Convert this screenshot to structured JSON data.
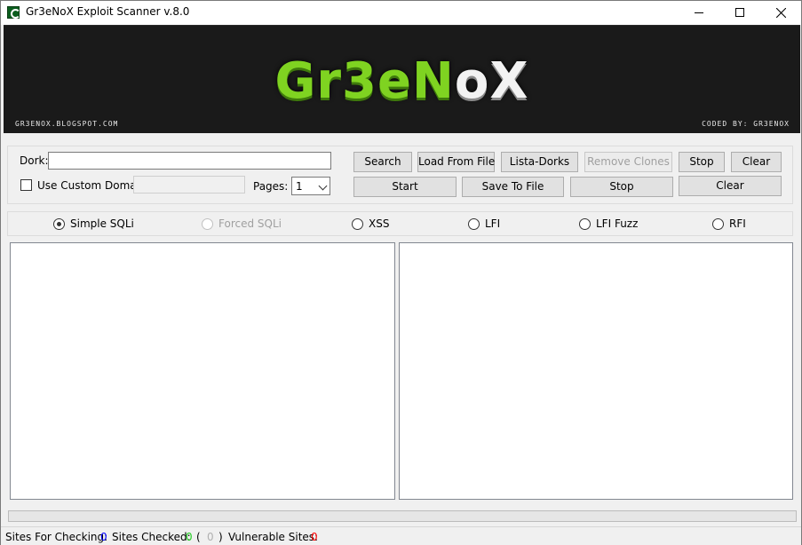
{
  "window": {
    "title": "Gr3eNoX Exploit Scanner v.8.0",
    "icon": "app-flag-icon",
    "controls": {
      "minimize": "minimize-icon",
      "maximize": "maximize-icon",
      "close": "close-icon"
    }
  },
  "banner": {
    "logo_green": "Gr3eN",
    "logo_white": "oX",
    "left_text": "GR3ENOX.BLOGSPOT.COM",
    "right_text": "CODED BY: GR3ENOX",
    "logo_green_color": "#7fd321"
  },
  "search": {
    "dork_label": "Dork:",
    "dork_value": "",
    "custom_domain_label": "Use Custom Domain:",
    "custom_domain_checked": false,
    "custom_domain_value": "",
    "pages_label": "Pages:",
    "pages_value": "1"
  },
  "buttons_row1": {
    "search": "Search",
    "load_from_file": "Load From File",
    "lista_dorks": "Lista-Dorks",
    "remove_clones": "Remove Clones",
    "stop": "Stop",
    "clear": "Clear"
  },
  "buttons_row2": {
    "start": "Start",
    "save_to_file": "Save To File",
    "stop": "Stop",
    "clear": "Clear"
  },
  "scan_modes": [
    {
      "label": "Simple SQLi",
      "checked": true,
      "enabled": true
    },
    {
      "label": "Forced SQLi",
      "checked": false,
      "enabled": false
    },
    {
      "label": "XSS",
      "checked": false,
      "enabled": true
    },
    {
      "label": "LFI",
      "checked": false,
      "enabled": true
    },
    {
      "label": "LFI Fuzz",
      "checked": false,
      "enabled": true
    },
    {
      "label": "RFI",
      "checked": false,
      "enabled": true
    }
  ],
  "progress": {
    "value": 0
  },
  "status": {
    "sites_for_checking_label": "Sites For Checking:",
    "sites_for_checking_value": "0",
    "sites_checked_label": "Sites Checked:",
    "sites_checked_value": "0",
    "paren_open": "(",
    "paren_value": "0",
    "paren_close": ")",
    "vulnerable_label": "Vulnerable Sites:",
    "vulnerable_value": "0",
    "colors": {
      "for_checking": "#0000ff",
      "checked": "#22cc22",
      "paren": "#b0b0b0",
      "vulnerable": "#ff0000"
    }
  }
}
